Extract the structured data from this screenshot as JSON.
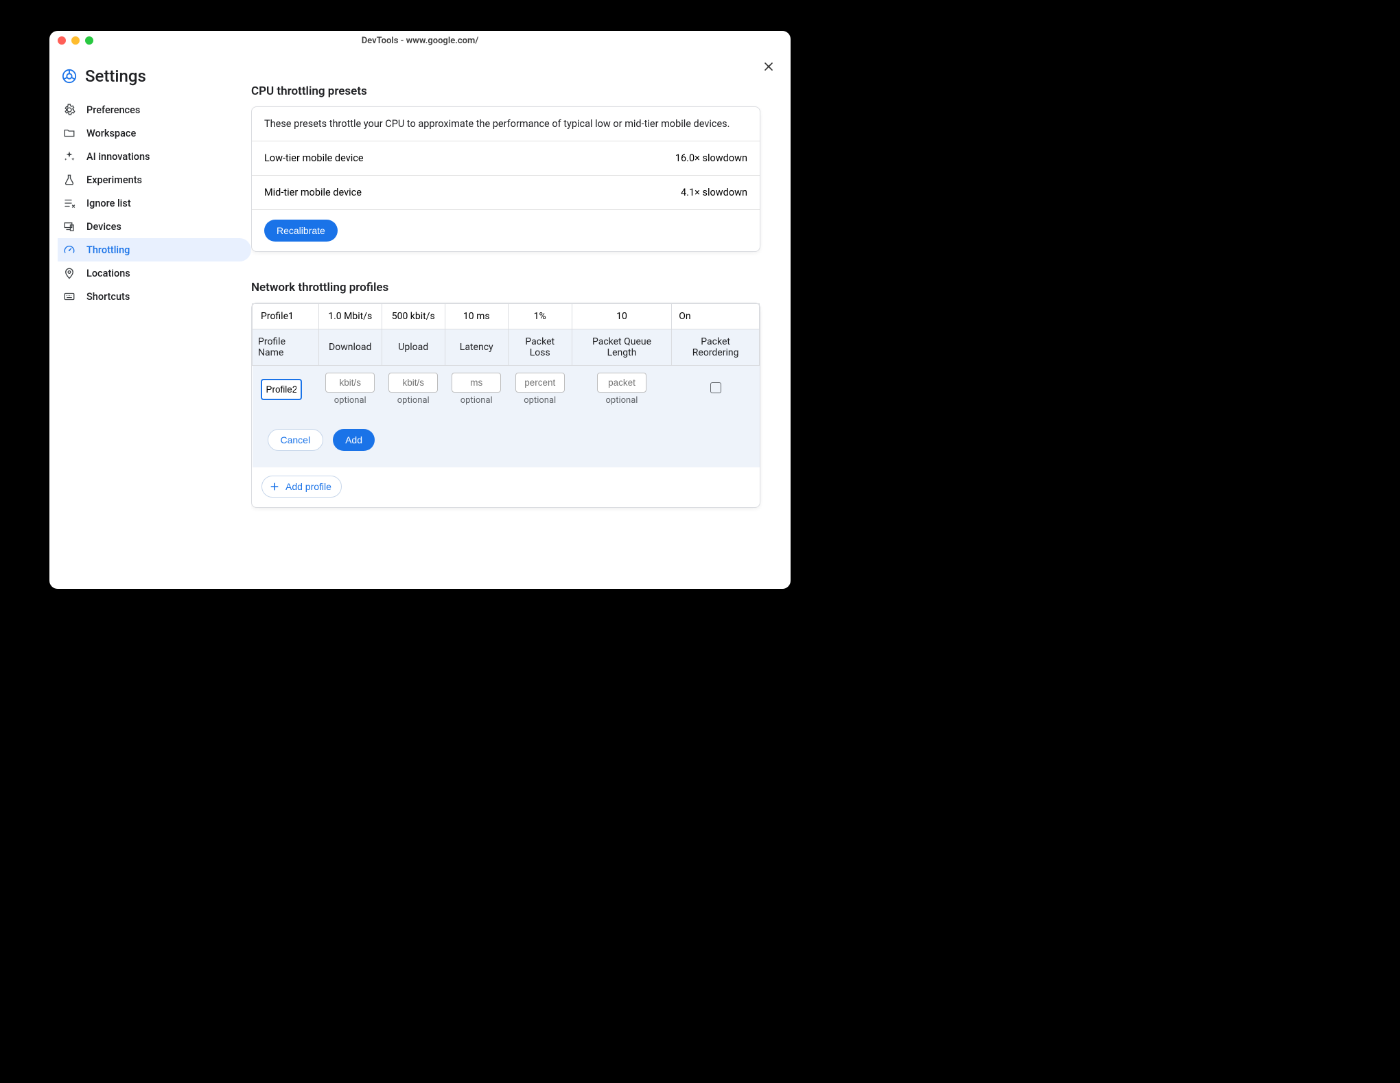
{
  "window_title": "DevTools - www.google.com/",
  "page_title": "Settings",
  "sidebar": {
    "items": [
      {
        "label": "Preferences",
        "icon": "gear-icon"
      },
      {
        "label": "Workspace",
        "icon": "folder-icon"
      },
      {
        "label": "AI innovations",
        "icon": "sparkle-icon"
      },
      {
        "label": "Experiments",
        "icon": "flask-icon"
      },
      {
        "label": "Ignore list",
        "icon": "ignore-list-icon"
      },
      {
        "label": "Devices",
        "icon": "devices-icon"
      },
      {
        "label": "Throttling",
        "icon": "speedometer-icon"
      },
      {
        "label": "Locations",
        "icon": "pin-icon"
      },
      {
        "label": "Shortcuts",
        "icon": "keyboard-icon"
      }
    ],
    "active_index": 6
  },
  "cpu_section": {
    "title": "CPU throttling presets",
    "description": "These presets throttle your CPU to approximate the performance of typical low or mid-tier mobile devices.",
    "rows": [
      {
        "name": "Low-tier mobile device",
        "value": "16.0× slowdown"
      },
      {
        "name": "Mid-tier mobile device",
        "value": "4.1× slowdown"
      }
    ],
    "recalibrate_label": "Recalibrate"
  },
  "net_section": {
    "title": "Network throttling profiles",
    "existing": {
      "name": "Profile1",
      "download": "1.0 Mbit/s",
      "upload": "500 kbit/s",
      "latency": "10 ms",
      "packet_loss": "1%",
      "queue_length": "10",
      "reordering": "On"
    },
    "headers": {
      "name": "Profile Name",
      "download": "Download",
      "upload": "Upload",
      "latency": "Latency",
      "packet_loss": "Packet Loss",
      "queue_length": "Packet Queue Length",
      "reordering": "Packet Reordering"
    },
    "form": {
      "name_value": "Profile2",
      "download_placeholder": "kbit/s",
      "upload_placeholder": "kbit/s",
      "latency_placeholder": "ms",
      "packet_loss_placeholder": "percent",
      "queue_placeholder": "packet",
      "optional_label": "optional",
      "reordering_checked": false
    },
    "cancel_label": "Cancel",
    "add_label": "Add",
    "add_profile_label": "Add profile"
  }
}
